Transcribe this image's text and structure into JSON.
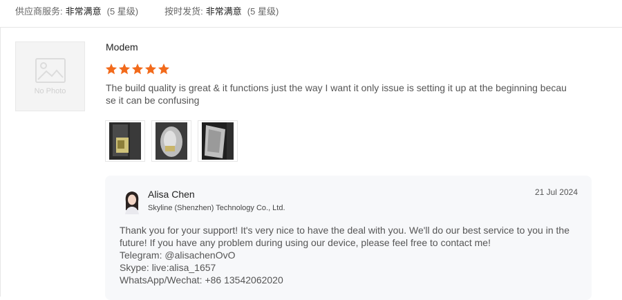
{
  "ratings": [
    {
      "label": "供应商服务:",
      "value": "非常满意",
      "level": "(5 星级)"
    },
    {
      "label": "按时发货:",
      "value": "非常满意",
      "level": "(5 星级)"
    }
  ],
  "reviewer": {
    "avatar_icon": "no-photo-icon",
    "no_photo_text": "No Photo"
  },
  "review": {
    "product": "Modem",
    "stars": 5,
    "star_color": "#f26a1b",
    "text": "The build quality is great & it functions just the way I want it only issue is setting it up at the beginning because it can be confusing",
    "photos": [
      "review-photo-1",
      "review-photo-2",
      "review-photo-3"
    ]
  },
  "reply": {
    "name": "Alisa Chen",
    "company": "Skyline (Shenzhen) Technology Co., Ltd.",
    "date": "21 Jul 2024",
    "lines": [
      "Thank you for your support! It's very nice to have the deal with you. We'll do our best service to you in the future! If you have any problem during using our device, please feel free to contact me!",
      "Telegram: @alisachenOvO",
      "Skype: live:alisa_1657",
      "WhatsApp/Wechat: +86 13542062020"
    ]
  }
}
